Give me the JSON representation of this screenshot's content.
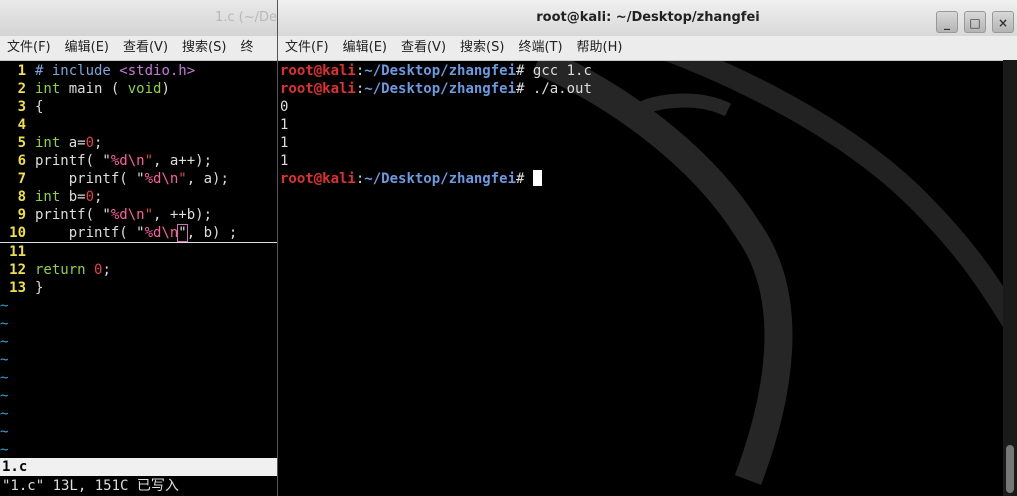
{
  "vim_window": {
    "title": "1.c (~/De",
    "menu": [
      "文件(F)",
      "编辑(E)",
      "查看(V)",
      "搜索(S)",
      "终"
    ],
    "status_name": "1.c",
    "command_line": "\"1.c\" 13L, 151C 已写入",
    "lines": [
      {
        "n": "1",
        "parts": [
          [
            "pre",
            "# include "
          ],
          [
            "inc",
            "<stdio.h>"
          ]
        ]
      },
      {
        "n": "2",
        "parts": [
          [
            "kw",
            "int"
          ],
          [
            "txt",
            " main ( "
          ],
          [
            "kw",
            "void"
          ],
          [
            "txt",
            ")"
          ]
        ]
      },
      {
        "n": "3",
        "parts": [
          [
            "txt",
            "{"
          ]
        ]
      },
      {
        "n": "4",
        "parts": []
      },
      {
        "n": "5",
        "parts": [
          [
            "kw",
            "int"
          ],
          [
            "txt",
            " a="
          ],
          [
            "num",
            "0"
          ],
          [
            "txt",
            ";"
          ]
        ]
      },
      {
        "n": "6",
        "parts": [
          [
            "txt",
            "printf( \""
          ],
          [
            "esc",
            "%d\\n"
          ],
          [
            "str",
            "\""
          ],
          [
            "txt",
            ", a++);"
          ]
        ]
      },
      {
        "n": "7",
        "parts": [
          [
            "txt",
            "    printf( \""
          ],
          [
            "esc",
            "%d\\n"
          ],
          [
            "str",
            "\""
          ],
          [
            "txt",
            ", a);"
          ]
        ]
      },
      {
        "n": "8",
        "parts": [
          [
            "kw",
            "int"
          ],
          [
            "txt",
            " b="
          ],
          [
            "num",
            "0"
          ],
          [
            "txt",
            ";"
          ]
        ]
      },
      {
        "n": "9",
        "parts": [
          [
            "txt",
            "printf( \""
          ],
          [
            "esc",
            "%d\\n"
          ],
          [
            "str",
            "\""
          ],
          [
            "txt",
            ", ++b);"
          ]
        ]
      },
      {
        "n": "10",
        "parts": [
          [
            "txt",
            "    printf( \""
          ],
          [
            "esc",
            "%d\\n"
          ],
          [
            "bracket",
            "\""
          ],
          [
            "txt",
            ", b) ;"
          ]
        ]
      },
      {
        "n": "11",
        "parts": []
      },
      {
        "n": "12",
        "parts": [
          [
            "kw",
            "return"
          ],
          [
            "txt",
            " "
          ],
          [
            "num",
            "0"
          ],
          [
            "txt",
            ";"
          ]
        ]
      },
      {
        "n": "13",
        "parts": [
          [
            "txt",
            "}"
          ]
        ]
      }
    ],
    "tilde_count": 9
  },
  "terminal_window": {
    "title": "root@kali: ~/Desktop/zhangfei",
    "menu": [
      "文件(F)",
      "编辑(E)",
      "查看(V)",
      "搜索(S)",
      "终端(T)",
      "帮助(H)"
    ],
    "buttons": [
      "_",
      "□",
      "×"
    ],
    "prompt_user": "root@kali",
    "prompt_path": "~/Desktop/zhangfei",
    "prompt_symbol": "#",
    "commands": [
      "gcc 1.c",
      "./a.out"
    ],
    "output": [
      "0",
      "1",
      "1",
      "1"
    ]
  },
  "colors": {
    "prompt_user": "#e03030",
    "prompt_path": "#6a9ae0",
    "line_number": "#f0e040",
    "keyword": "#8fd33b",
    "string": "#e04444"
  }
}
